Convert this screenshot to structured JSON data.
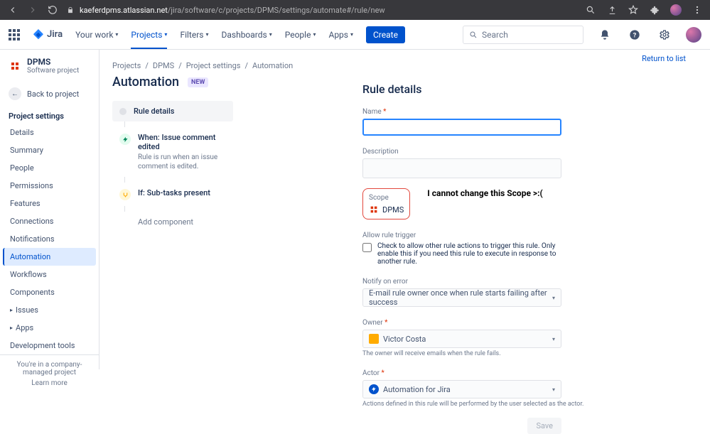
{
  "browser": {
    "url_domain": "kaeferdpms.atlassian.net",
    "url_path": "/jira/software/c/projects/DPMS/settings/automate#/rule/new"
  },
  "topnav": {
    "brand": "Jira",
    "items": [
      "Your work",
      "Projects",
      "Filters",
      "Dashboards",
      "People",
      "Apps"
    ],
    "create": "Create",
    "search_placeholder": "Search"
  },
  "sidebar": {
    "project_name": "DPMS",
    "project_sub": "Software project",
    "back": "Back to project",
    "section": "Project settings",
    "items": [
      "Details",
      "Summary",
      "People",
      "Permissions",
      "Features",
      "Connections",
      "Notifications",
      "Automation",
      "Workflows",
      "Components"
    ],
    "active_index": 7,
    "groups": [
      "Issues",
      "Apps"
    ],
    "dev_tools": "Development tools",
    "footer1": "You're in a company-managed project",
    "footer2": "Learn more"
  },
  "breadcrumb": [
    "Projects",
    "DPMS",
    "Project settings",
    "Automation"
  ],
  "page": {
    "title": "Automation",
    "badge": "NEW",
    "return": "Return to list"
  },
  "steps": {
    "header": "Rule details",
    "when_title": "When: Issue comment edited",
    "when_sub": "Rule is run when an issue comment is edited.",
    "if_title": "If: Sub-tasks present",
    "add": "Add component"
  },
  "form": {
    "title": "Rule details",
    "name_label": "Name",
    "desc_label": "Description",
    "scope_label": "Scope",
    "scope_value": "DPMS",
    "annotation": "I cannot change this Scope >:(",
    "allow_label": "Allow rule trigger",
    "allow_desc": "Check to allow other rule actions to trigger this rule. Only enable this if you need this rule to execute in response to another rule.",
    "notify_label": "Notify on error",
    "notify_value": "E-mail rule owner once when rule starts failing after success",
    "owner_label": "Owner",
    "owner_value": "Victor Costa",
    "owner_hint": "The owner will receive emails when the rule fails.",
    "actor_label": "Actor",
    "actor_value": "Automation for Jira",
    "actor_hint": "Actions defined in this rule will be performed by the user selected as the actor.",
    "save": "Save"
  }
}
